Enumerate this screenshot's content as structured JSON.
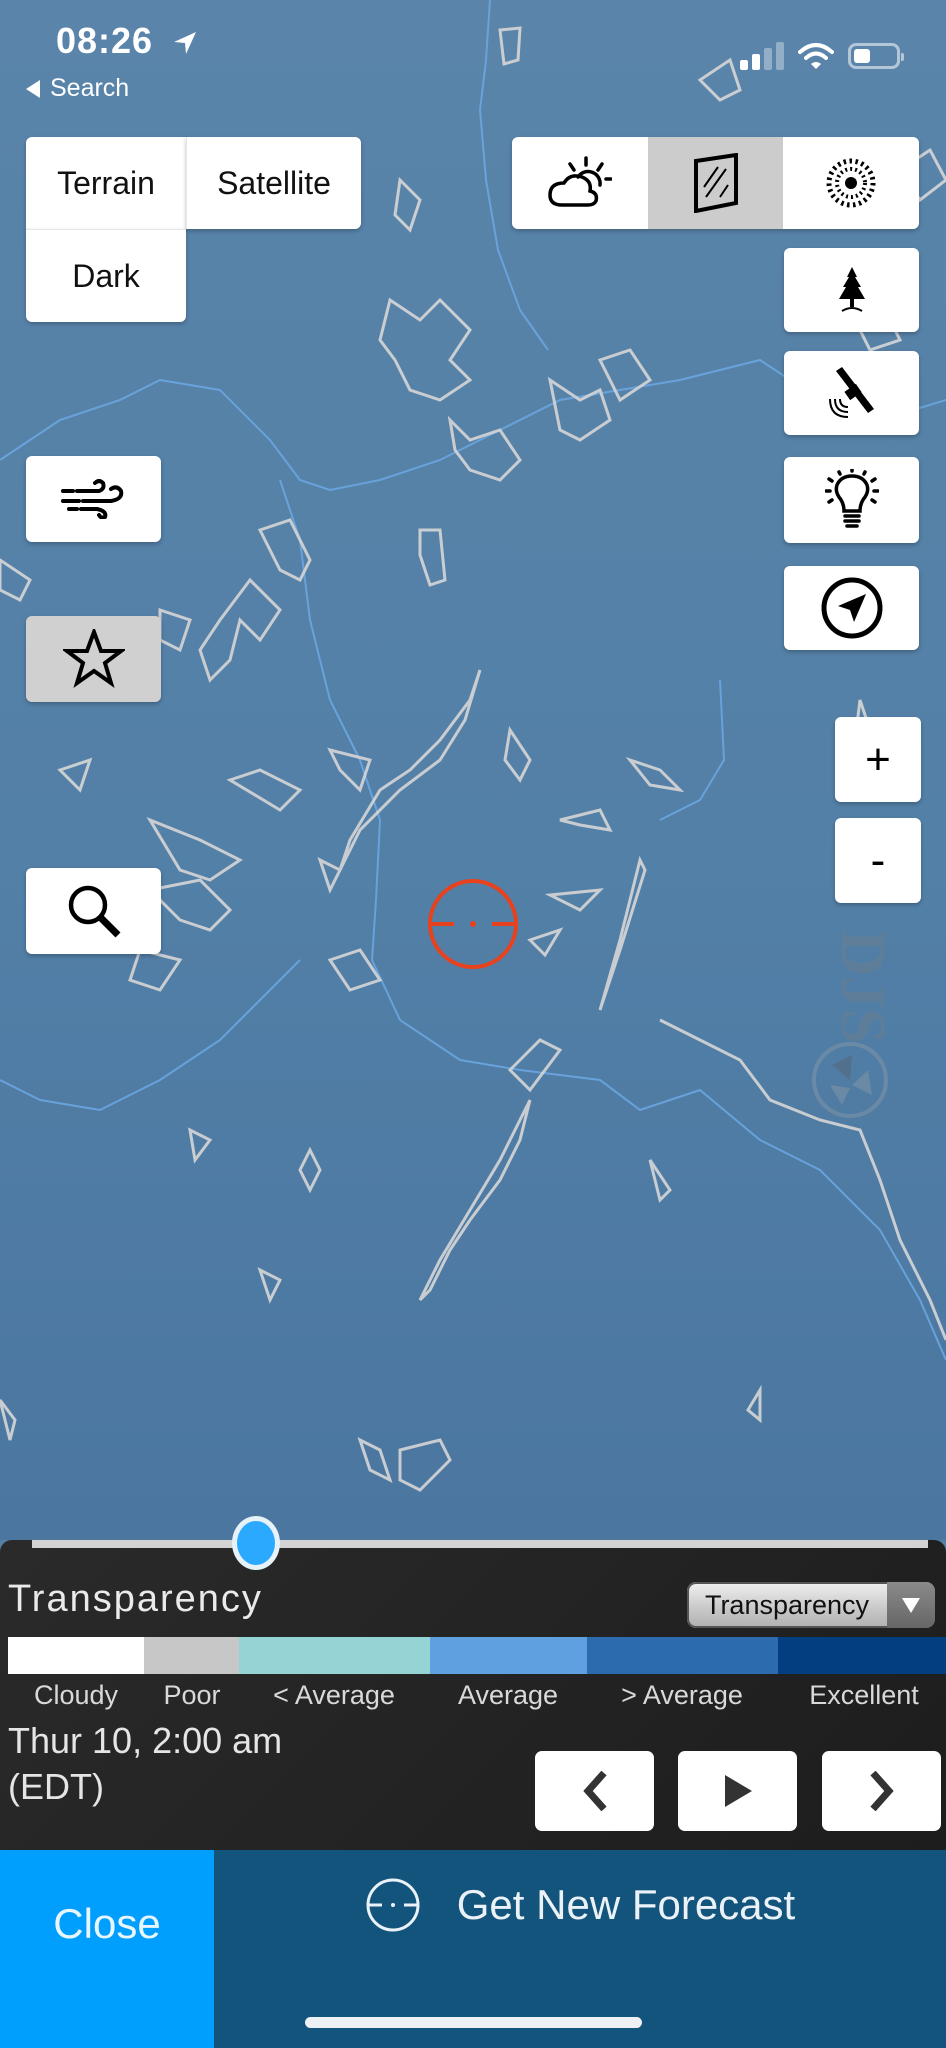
{
  "status_bar": {
    "time": "08:26",
    "back_label": "Search",
    "location_icon": "location-arrow-icon",
    "signal_icon": "cellular-signal-icon",
    "wifi_icon": "wifi-icon",
    "battery_icon": "battery-icon",
    "signal_bars_active": 2,
    "signal_bars_total": 4,
    "battery_level": 0.35
  },
  "map_types": {
    "terrain": "Terrain",
    "satellite": "Satellite",
    "dark": "Dark"
  },
  "layer_toggle": {
    "items": [
      {
        "icon": "partly-cloudy-icon",
        "active": false
      },
      {
        "icon": "transparency-glass-icon",
        "active": true
      },
      {
        "icon": "seeing-sun-icon",
        "active": false
      }
    ]
  },
  "right_tools": [
    {
      "icon": "tree-icon"
    },
    {
      "icon": "satellite-icon"
    },
    {
      "icon": "lightbulb-icon"
    },
    {
      "icon": "navigation-compass-icon"
    }
  ],
  "left_tools": [
    {
      "icon": "wind-icon",
      "active": false
    },
    {
      "icon": "star-icon",
      "active": true
    },
    {
      "icon": "search-icon",
      "active": false
    }
  ],
  "zoom": {
    "in_label": "+",
    "out_label": "-"
  },
  "watermark": {
    "text": "DJS"
  },
  "panel": {
    "timeline_position": 0.25,
    "title": "Transparency",
    "layer_select_value": "Transparency",
    "legend": [
      {
        "label": "Cloudy",
        "color": "#ffffff"
      },
      {
        "label": "Poor",
        "color": "#c7c7c7"
      },
      {
        "label": "< Average",
        "color": "#95d4d4"
      },
      {
        "label": "Average",
        "color": "#5fa0e0"
      },
      {
        "label": "> Average",
        "color": "#2d6baf"
      },
      {
        "label": "Excellent",
        "color": "#033f80"
      }
    ],
    "time_line1": "Thur 10, 2:00 am",
    "time_line2": "(EDT)",
    "nav": {
      "prev_icon": "chevron-left-icon",
      "play_icon": "play-icon",
      "next_icon": "chevron-right-icon"
    }
  },
  "footer": {
    "close_label": "Close",
    "forecast_label": "Get New Forecast",
    "accent_color": "#009ffd",
    "bar_color": "#13547c"
  },
  "crosshair_color": "#e8411e"
}
